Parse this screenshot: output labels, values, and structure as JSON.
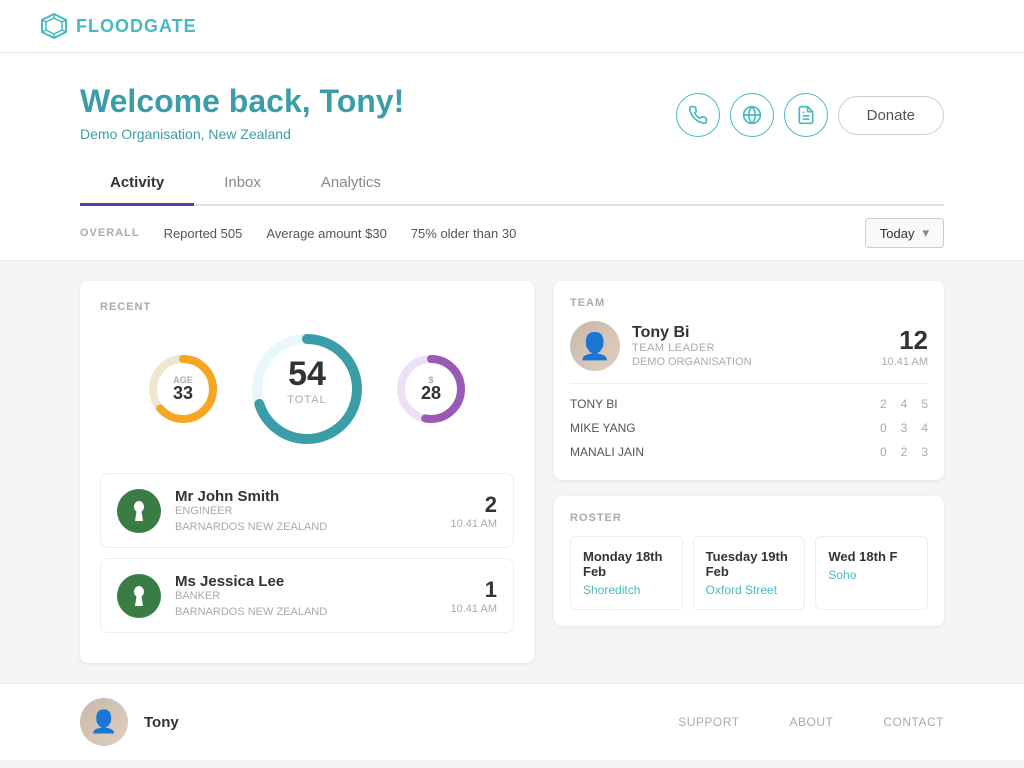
{
  "app": {
    "logo_text_bold": "FLOOD",
    "logo_text_light": "GATE",
    "logo_icon": "◈"
  },
  "header": {
    "welcome": "Welcome back, Tony!",
    "org": "Demo Organisation, New Zealand",
    "icons": {
      "phone": "📞",
      "globe": "🌐",
      "doc": "📄"
    },
    "donate_label": "Donate"
  },
  "tabs": [
    {
      "id": "activity",
      "label": "Activity",
      "active": true
    },
    {
      "id": "inbox",
      "label": "Inbox",
      "active": false
    },
    {
      "id": "analytics",
      "label": "Analytics",
      "active": false
    }
  ],
  "stats_bar": {
    "overall_label": "OVERALL",
    "reported": "Reported 505",
    "average": "Average amount $30",
    "age": "75% older than 30",
    "dropdown_label": "Today"
  },
  "recent": {
    "label": "RECENT",
    "age_ring": {
      "label": "AGE",
      "value": "33",
      "color": "#f5a623",
      "bg": "#f0e6d0"
    },
    "total": {
      "value": "54",
      "sub": "TOTAL",
      "color": "#3a9da8"
    },
    "dollar_ring": {
      "label": "$",
      "value": "28",
      "color": "#9b59b6",
      "bg": "#ede0f5"
    },
    "people": [
      {
        "name": "Mr John Smith",
        "role": "ENGINEER",
        "org": "BARNARDOS NEW ZEALAND",
        "count": "2",
        "time": "10.41 AM",
        "avatar_color": "#3a7d44",
        "avatar_icon": "🌿"
      },
      {
        "name": "Ms Jessica Lee",
        "role": "BANKER",
        "org": "BARNARDOS NEW ZEALAND",
        "count": "1",
        "time": "10.41 AM",
        "avatar_color": "#3a7d44",
        "avatar_icon": "🌿"
      }
    ]
  },
  "team": {
    "label": "TEAM",
    "leader": {
      "name": "Tony Bi",
      "role": "TEAM LEADER",
      "org": "DEMO ORGANISATION",
      "count": "12",
      "time": "10.41 AM"
    },
    "members": [
      {
        "name": "TONY BI",
        "s1": "2",
        "s2": "4",
        "s3": "5"
      },
      {
        "name": "MIKE YANG",
        "s1": "0",
        "s2": "3",
        "s3": "4"
      },
      {
        "name": "MANALI JAIN",
        "s1": "0",
        "s2": "2",
        "s3": "3"
      }
    ]
  },
  "roster": {
    "label": "ROSTER",
    "dates": [
      {
        "date": "Monday 18th Feb",
        "location": "Shoreditch"
      },
      {
        "date": "Tuesday 19th Feb",
        "location": "Oxford Street"
      },
      {
        "date": "Wed 18th F",
        "location": "Soho"
      }
    ]
  },
  "footer": {
    "name": "Tony",
    "links": [
      "SUPPORT",
      "ABOUT",
      "CONTACT"
    ]
  }
}
